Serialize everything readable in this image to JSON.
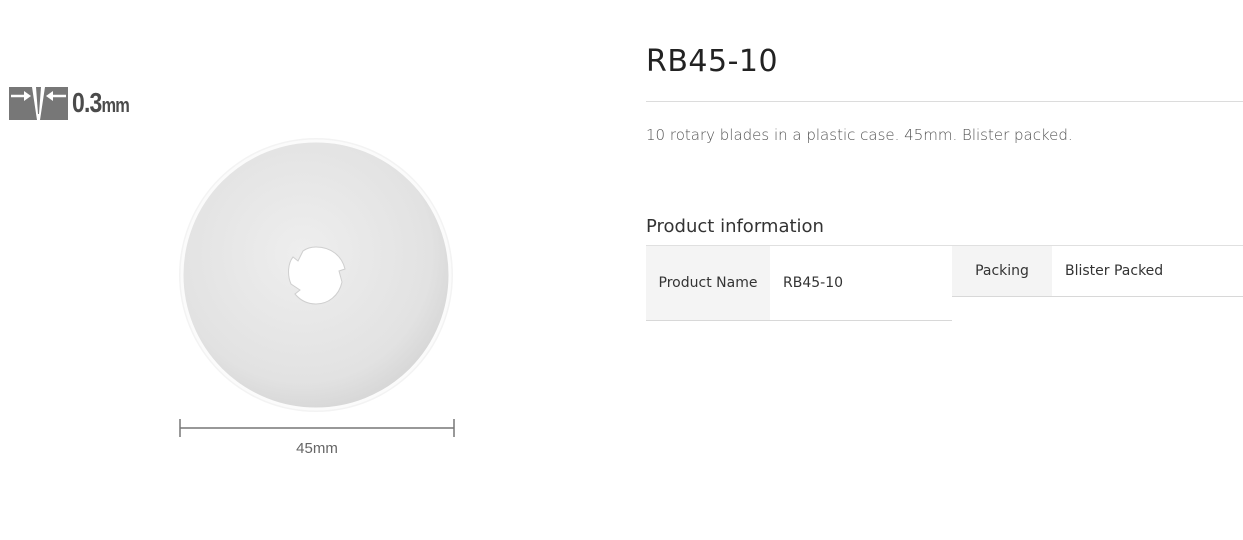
{
  "thickness": {
    "value": "0.3",
    "unit": "mm",
    "icon": "blade-thickness-icon"
  },
  "product_image": {
    "alt": "rotary-blade",
    "dimension_label": "45mm"
  },
  "product": {
    "title": "RB45-10",
    "description": "10 rotary blades in a plastic case. 45mm. Blister packed."
  },
  "info_section": {
    "heading": "Product information",
    "rows": [
      {
        "label": "Product Name",
        "value": "RB45-10"
      },
      {
        "label": "Packing",
        "value": "Blister Packed"
      }
    ]
  },
  "colors": {
    "title_text": "#222222",
    "body_text": "#555555",
    "table_header_bg": "#f4f4f4",
    "divider": "#dcdcdc",
    "blade_fill": "#e6e6e6",
    "badge_gray": "#777777"
  }
}
